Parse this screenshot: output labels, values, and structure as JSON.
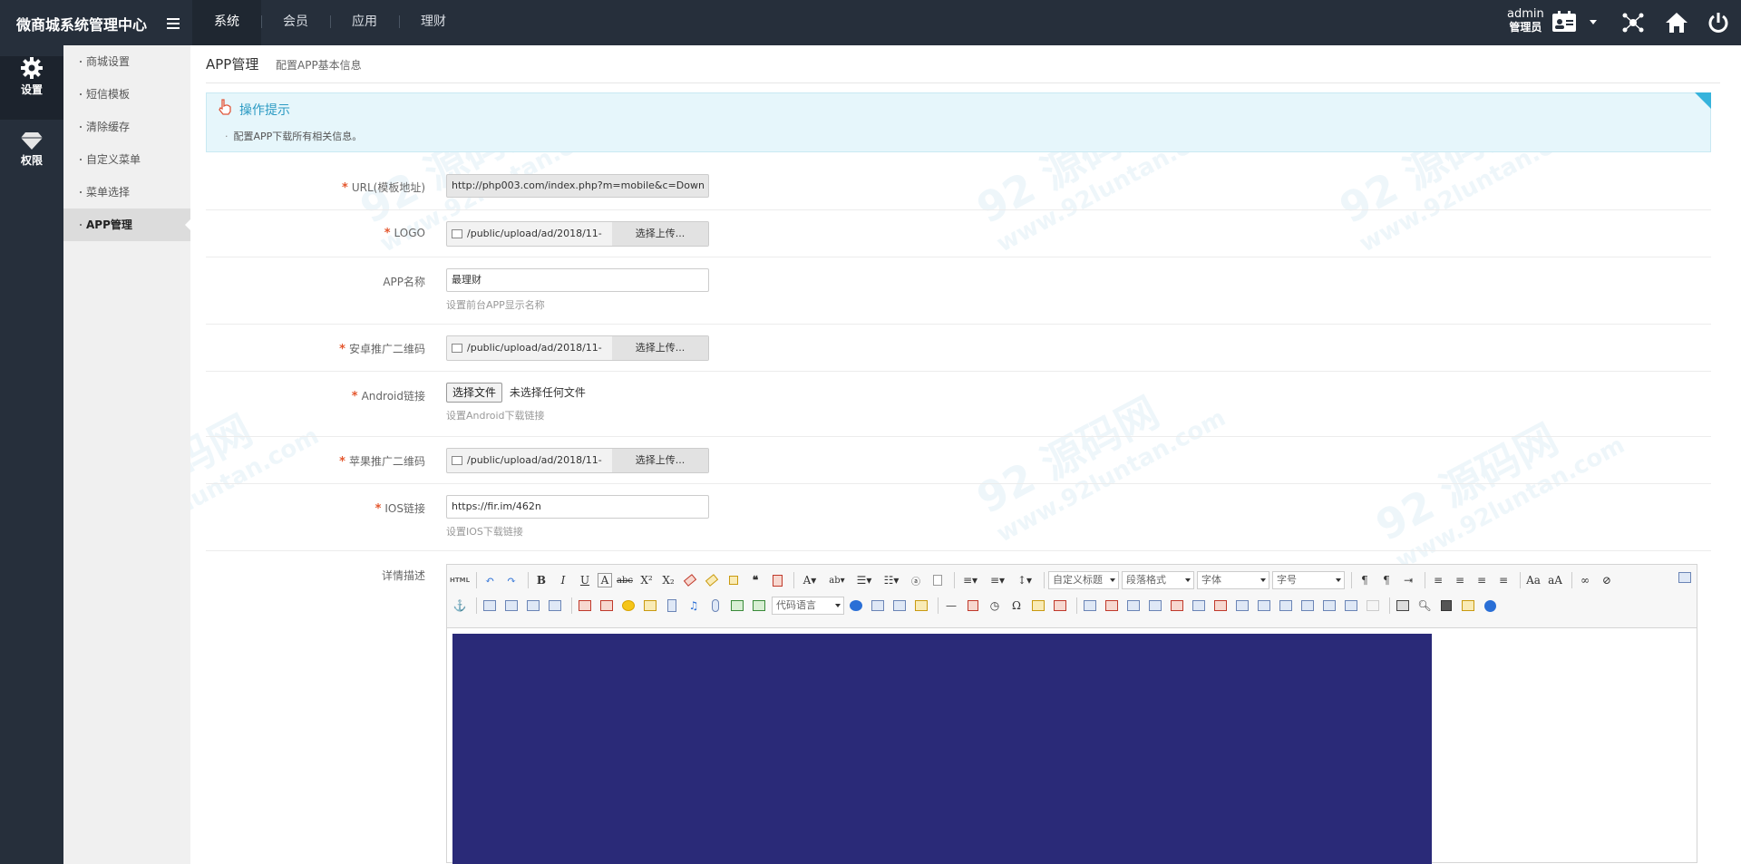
{
  "app": {
    "title": "微商城系统管理中心"
  },
  "topnav": {
    "items": [
      "系统",
      "会员",
      "应用",
      "理财"
    ],
    "active": "系统"
  },
  "user": {
    "name": "admin",
    "role": "管理员"
  },
  "iconbar": {
    "items": [
      {
        "label": "设置",
        "icon": "gear-icon"
      },
      {
        "label": "权限",
        "icon": "diamond-icon"
      }
    ]
  },
  "submenu": {
    "items": [
      "商城设置",
      "短信模板",
      "清除缓存",
      "自定义菜单",
      "菜单选择",
      "APP管理"
    ],
    "active": "APP管理"
  },
  "page": {
    "title": "APP管理",
    "subtitle": "配置APP基本信息"
  },
  "tips": {
    "title": "操作提示",
    "text": "配置APP下载所有相关信息。"
  },
  "form": {
    "url": {
      "label": "URL(模板地址)",
      "value": "http://php003.com/index.php?m=mobile&c=Down"
    },
    "logo": {
      "label": "LOGO",
      "path": "/public/upload/ad/2018/11-",
      "button": "选择上传..."
    },
    "app_name": {
      "label": "APP名称",
      "value": "最理财",
      "hint": "设置前台APP显示名称"
    },
    "android_qr": {
      "label": "安卓推广二维码",
      "path": "/public/upload/ad/2018/11-",
      "button": "选择上传..."
    },
    "android_link": {
      "label": "Android链接",
      "button": "选择文件",
      "status": "未选择任何文件",
      "hint": "设置Android下载链接"
    },
    "ios_qr": {
      "label": "苹果推广二维码",
      "path": "/public/upload/ad/2018/11-",
      "button": "选择上传..."
    },
    "ios_link": {
      "label": "IOS链接",
      "value": "https://fir.im/462n",
      "hint": "设置IOS下载链接"
    },
    "detail": {
      "label": "详情描述"
    }
  },
  "editor": {
    "selects": [
      "自定义标题",
      "段落格式",
      "字体",
      "字号",
      "代码语言"
    ],
    "html_label": "HTML"
  },
  "watermark": {
    "text": "92 源码网",
    "url": "www.92luntan.com"
  }
}
